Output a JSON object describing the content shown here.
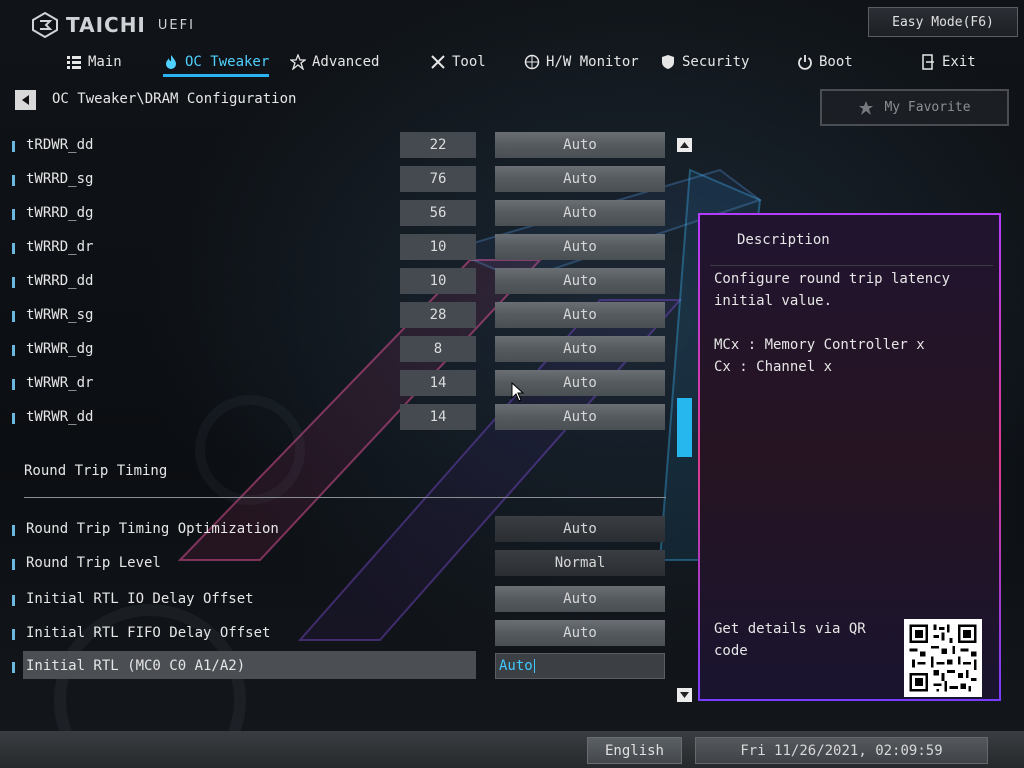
{
  "brand": {
    "name": "TAICHI",
    "sub": "UEFI"
  },
  "header": {
    "easy_mode": "Easy Mode(F6)"
  },
  "nav": [
    {
      "label": "Main",
      "icon": "list-icon",
      "active": false
    },
    {
      "label": "OC Tweaker",
      "icon": "flame-icon",
      "active": true
    },
    {
      "label": "Advanced",
      "icon": "star-icon",
      "active": false
    },
    {
      "label": "Tool",
      "icon": "tools-icon",
      "active": false
    },
    {
      "label": "H/W Monitor",
      "icon": "monitor-icon",
      "active": false
    },
    {
      "label": "Security",
      "icon": "shield-icon",
      "active": false
    },
    {
      "label": "Boot",
      "icon": "power-icon",
      "active": false
    },
    {
      "label": "Exit",
      "icon": "exit-icon",
      "active": false
    }
  ],
  "breadcrumb": {
    "path": "OC Tweaker\\DRAM Configuration"
  },
  "favorite": {
    "label": "My Favorite"
  },
  "timings": [
    {
      "label": "tRDWR_dd",
      "value": "22",
      "setting": "Auto"
    },
    {
      "label": "tWRRD_sg",
      "value": "76",
      "setting": "Auto"
    },
    {
      "label": "tWRRD_dg",
      "value": "56",
      "setting": "Auto"
    },
    {
      "label": "tWRRD_dr",
      "value": "10",
      "setting": "Auto"
    },
    {
      "label": "tWRRD_dd",
      "value": "10",
      "setting": "Auto"
    },
    {
      "label": "tWRWR_sg",
      "value": "28",
      "setting": "Auto"
    },
    {
      "label": "tWRWR_dg",
      "value": "8",
      "setting": "Auto"
    },
    {
      "label": "tWRWR_dr",
      "value": "14",
      "setting": "Auto"
    },
    {
      "label": "tWRWR_dd",
      "value": "14",
      "setting": "Auto"
    }
  ],
  "section": {
    "title": "Round Trip Timing"
  },
  "rtt": [
    {
      "label": "Round Trip Timing Optimization",
      "setting": "Auto"
    },
    {
      "label": "Round Trip Level",
      "setting": "Normal"
    },
    {
      "label": "Initial RTL IO Delay Offset",
      "setting": "Auto"
    },
    {
      "label": "Initial RTL FIFO Delay Offset",
      "setting": "Auto"
    },
    {
      "label": "Initial RTL (MC0 C0 A1/A2)",
      "setting": "Auto"
    }
  ],
  "description": {
    "title": "Description",
    "lines": [
      "Configure round trip latency",
      "initial value.",
      "",
      "MCx : Memory Controller x",
      "Cx : Channel x"
    ],
    "qr_text_1": "Get details via QR",
    "qr_text_2": "code"
  },
  "footer": {
    "language": "English",
    "datetime": "Fri 11/26/2021, 02:09:59"
  },
  "colors": {
    "accent": "#2ab3f0",
    "active_text": "#4fd1ff",
    "panel_border": "#b43cff"
  }
}
